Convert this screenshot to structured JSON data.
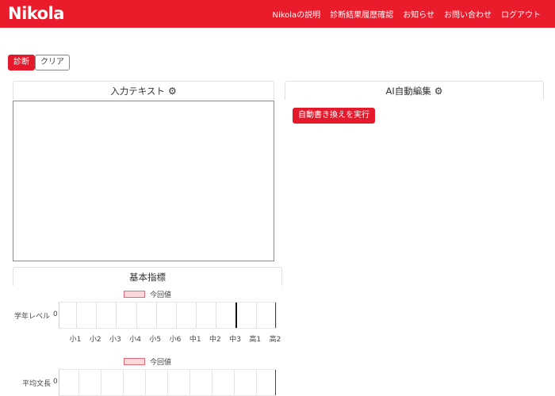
{
  "header": {
    "brand": "Nikola",
    "nav": [
      "Nikolaの説明",
      "診断結果履歴確認",
      "お知らせ",
      "お問い合わせ",
      "ログアウト"
    ]
  },
  "toolbar": {
    "diagnose_label": "診断",
    "clear_label": "クリア"
  },
  "input_panel": {
    "title": "入力テキスト",
    "text": ""
  },
  "ai_panel": {
    "title": "AI自動編集",
    "rewrite_label": "自動書き換えを実行"
  },
  "metrics": {
    "title": "基本指標",
    "legend_label": "今回値",
    "grade": {
      "label": "学年レベル",
      "value": "0",
      "ticks": [
        "小1",
        "小2",
        "小3",
        "小4",
        "小5",
        "小6",
        "中1",
        "中2",
        "中3",
        "高1",
        "高2"
      ],
      "marker_tick": "中3"
    },
    "sentence_length": {
      "label": "平均文長",
      "value": "0",
      "legend_label": "今回値"
    }
  },
  "colors": {
    "brand_red": "#ea1c2c",
    "button_red": "#e4192b"
  },
  "icons": {
    "settings": "gear-icon"
  }
}
